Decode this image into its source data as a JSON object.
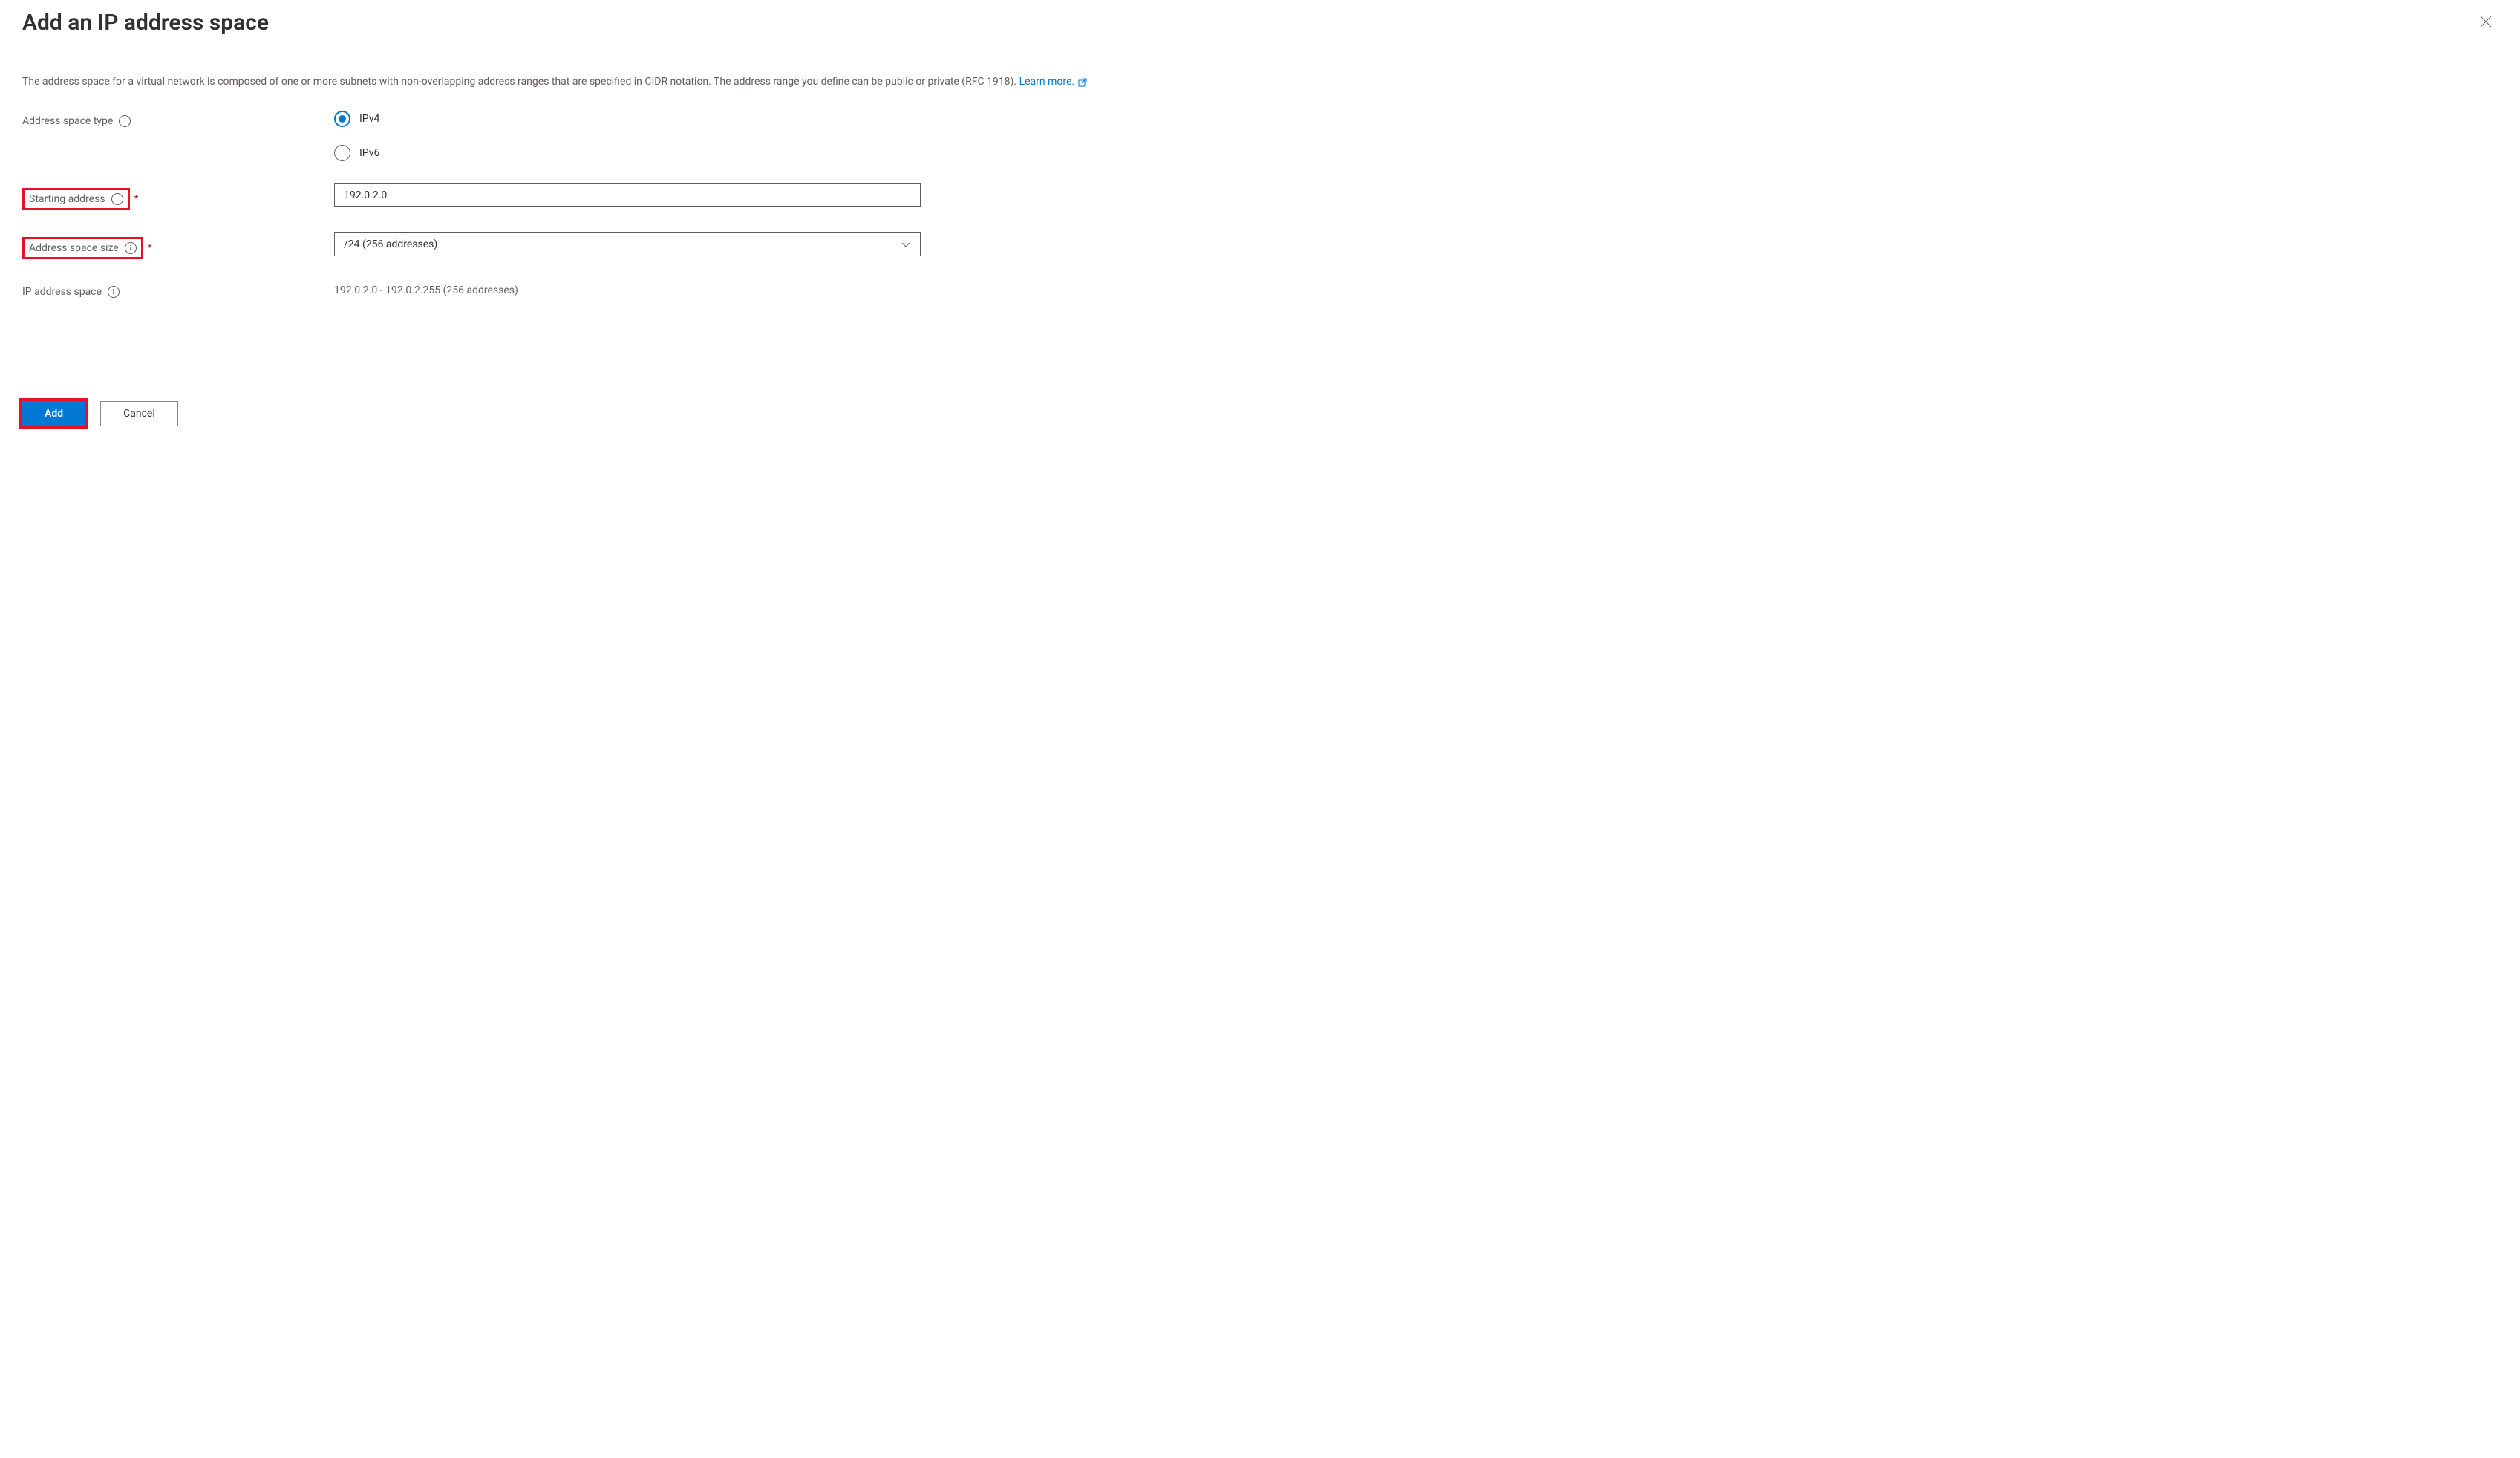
{
  "header": {
    "title": "Add an IP address space"
  },
  "description": {
    "text_before_link": "The address space for a virtual network is composed of one or more subnets with non-overlapping address ranges that are specified in CIDR notation. The address range you define can be public or private (RFC 1918). ",
    "link_text": "Learn more."
  },
  "form": {
    "address_space_type": {
      "label": "Address space type",
      "options": {
        "ipv4": "IPv4",
        "ipv6": "IPv6"
      }
    },
    "starting_address": {
      "label": "Starting address",
      "value": "192.0.2.0"
    },
    "address_space_size": {
      "label": "Address space size",
      "value": "/24 (256 addresses)"
    },
    "ip_address_space": {
      "label": "IP address space",
      "value": "192.0.2.0 - 192.0.2.255 (256 addresses)"
    }
  },
  "footer": {
    "add_label": "Add",
    "cancel_label": "Cancel"
  }
}
